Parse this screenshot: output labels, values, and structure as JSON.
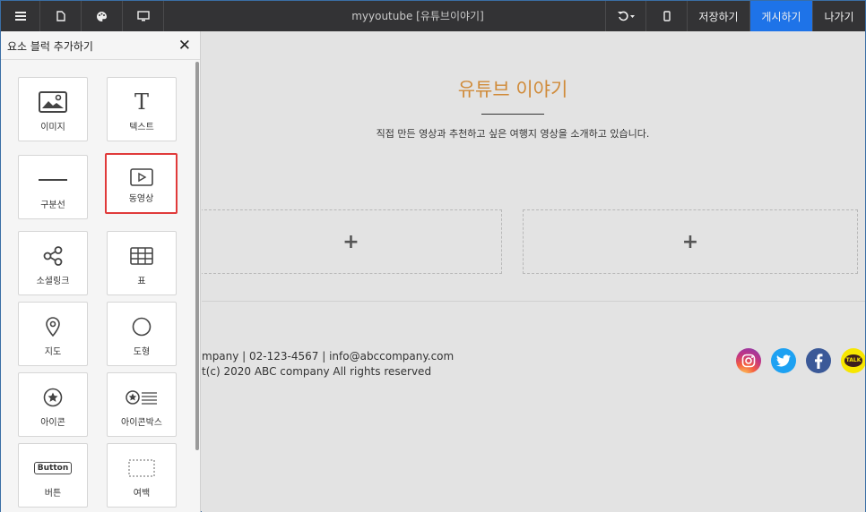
{
  "topbar": {
    "title": "myyoutube [유튜브이야기]",
    "save_label": "저장하기",
    "publish_label": "게시하기",
    "exit_label": "나가기",
    "accent": "#1e73e8"
  },
  "panel": {
    "title": "요소 블럭 추가하기",
    "close_glyph": "✕",
    "blocks": [
      {
        "label": "이미지",
        "icon": "image-icon"
      },
      {
        "label": "텍스트",
        "icon": "text-icon",
        "glyph": "T"
      },
      {
        "label": "구분선",
        "icon": "divider-icon"
      },
      {
        "label": "동영상",
        "icon": "video-icon",
        "selected": true
      },
      {
        "label": "소셜링크",
        "icon": "share-icon"
      },
      {
        "label": "표",
        "icon": "table-icon"
      },
      {
        "label": "지도",
        "icon": "map-pin-icon"
      },
      {
        "label": "도형",
        "icon": "circle-icon"
      },
      {
        "label": "아이콘",
        "icon": "star-icon"
      },
      {
        "label": "아이콘박스",
        "icon": "icon-box-icon"
      },
      {
        "label": "버튼",
        "icon": "button-icon",
        "glyph": "Button"
      },
      {
        "label": "여백",
        "icon": "spacer-icon"
      }
    ]
  },
  "canvas": {
    "headline": "유튜브 이야기",
    "headline_color": "#d08b3a",
    "subtitle": "직접 만든 영상과 추천하고 싶은 여행지 영상을 소개하고 있습니다.",
    "add_glyph": "+",
    "footer_line1": "mpany | 02-123-4567 | info@abccompany.com",
    "footer_line2": "t(c) 2020 ABC company All rights reserved",
    "social": [
      {
        "icon": "instagram-icon",
        "color": "#c13584"
      },
      {
        "icon": "twitter-icon",
        "color": "#1da1f2"
      },
      {
        "icon": "facebook-icon",
        "color": "#3b5998"
      },
      {
        "icon": "kakaotalk-icon",
        "color": "#f7e600",
        "text": "TALK"
      }
    ]
  }
}
